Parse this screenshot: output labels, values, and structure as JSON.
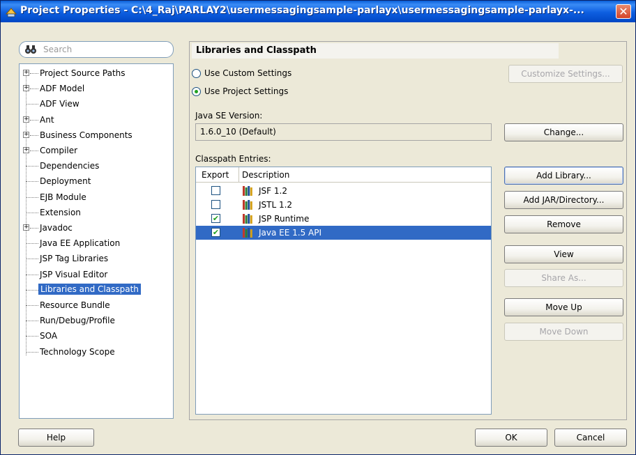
{
  "window": {
    "title": "Project Properties - C:\\4_Raj\\PARLAY2\\usermessagingsample-parlayx\\usermessagingsample-parlayx-...",
    "close": "✕"
  },
  "search": {
    "placeholder": "Search"
  },
  "tree": [
    {
      "label": "Project Source Paths",
      "expandable": true
    },
    {
      "label": "ADF Model",
      "expandable": true
    },
    {
      "label": "ADF View",
      "expandable": false
    },
    {
      "label": "Ant",
      "expandable": true
    },
    {
      "label": "Business Components",
      "expandable": true
    },
    {
      "label": "Compiler",
      "expandable": true
    },
    {
      "label": "Dependencies",
      "expandable": false
    },
    {
      "label": "Deployment",
      "expandable": false
    },
    {
      "label": "EJB Module",
      "expandable": false
    },
    {
      "label": "Extension",
      "expandable": false
    },
    {
      "label": "Javadoc",
      "expandable": true
    },
    {
      "label": "Java EE Application",
      "expandable": false
    },
    {
      "label": "JSP Tag Libraries",
      "expandable": false
    },
    {
      "label": "JSP Visual Editor",
      "expandable": false
    },
    {
      "label": "Libraries and Classpath",
      "expandable": false,
      "selected": true
    },
    {
      "label": "Resource Bundle",
      "expandable": false
    },
    {
      "label": "Run/Debug/Profile",
      "expandable": false
    },
    {
      "label": "SOA",
      "expandable": false
    },
    {
      "label": "Technology Scope",
      "expandable": false
    }
  ],
  "panel": {
    "title": "Libraries and Classpath",
    "use_custom": "Use Custom Settings",
    "use_project": "Use Project Settings",
    "customize_button": "Customize Settings...",
    "java_se_label": "Java SE Version:",
    "java_se_value": "1.6.0_10 (Default)",
    "change_button": "Change...",
    "classpath_label": "Classpath Entries:",
    "col_export": "Export",
    "col_description": "Description",
    "entries": [
      {
        "description": "JSF 1.2",
        "export": false
      },
      {
        "description": "JSTL 1.2",
        "export": false
      },
      {
        "description": "JSP Runtime",
        "export": true
      },
      {
        "description": "Java EE 1.5 API",
        "export": true,
        "selected": true
      }
    ],
    "buttons": {
      "add_library": "Add Library...",
      "add_jar": "Add JAR/Directory...",
      "remove": "Remove",
      "view": "View",
      "share_as": "Share As...",
      "move_up": "Move Up",
      "move_down": "Move Down"
    }
  },
  "footer": {
    "help": "Help",
    "ok": "OK",
    "cancel": "Cancel"
  },
  "colors": {
    "selection": "#316ac5",
    "titlebar": "#0a5fd8",
    "dialog_bg": "#ece9d8"
  }
}
